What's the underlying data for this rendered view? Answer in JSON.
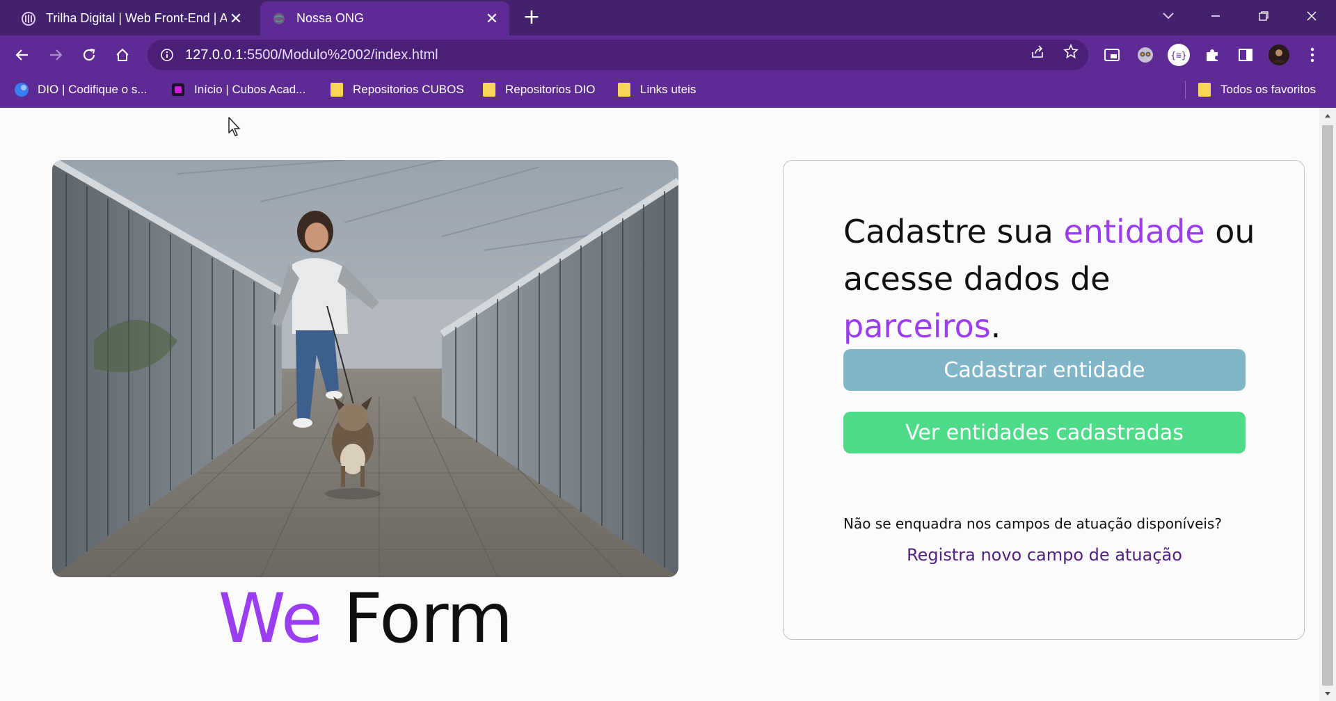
{
  "browser": {
    "tabs": [
      {
        "title": "Trilha Digital | Web Front-End | A",
        "active": false,
        "favicon": "dio-trilha-icon"
      },
      {
        "title": "Nossa ONG",
        "active": true,
        "favicon": "globe-icon"
      }
    ],
    "new_tab_label": "+",
    "address": {
      "host": "127.0.0.1",
      "path": ":5500/Modulo%2002/index.html"
    },
    "bookmarks": [
      {
        "label": "DIO | Codifique o s...",
        "icon": "dio-icon"
      },
      {
        "label": "Início | Cubos Acad...",
        "icon": "cubos-icon"
      },
      {
        "label": "Repositorios CUBOS",
        "icon": "folder-icon"
      },
      {
        "label": "Repositorios DIO",
        "icon": "folder-icon"
      },
      {
        "label": "Links uteis",
        "icon": "folder-icon"
      }
    ],
    "all_bookmarks_label": "Todos os favoritos",
    "colors": {
      "tabstrip": "#43226d",
      "toolbar": "#5e2a94",
      "omnibox": "#491f78"
    }
  },
  "page": {
    "brand": {
      "we": "We",
      "form": "Form"
    },
    "card": {
      "headline": {
        "part1": "Cadastre sua ",
        "highlight1": "entidade",
        "part2": " ou acesse dados de ",
        "highlight2": "parceiros",
        "part3": "."
      },
      "primary_button": "Cadastrar entidade",
      "secondary_button": "Ver entidades cadastradas",
      "question": "Não se enquadra nos campos de atuação disponíveis?",
      "register_link": "Registra novo campo de atuação"
    },
    "colors": {
      "accent": "#9b3df0",
      "primary_button": "#80b6c7",
      "secondary_button": "#4fdc88",
      "link": "#51217f"
    }
  }
}
